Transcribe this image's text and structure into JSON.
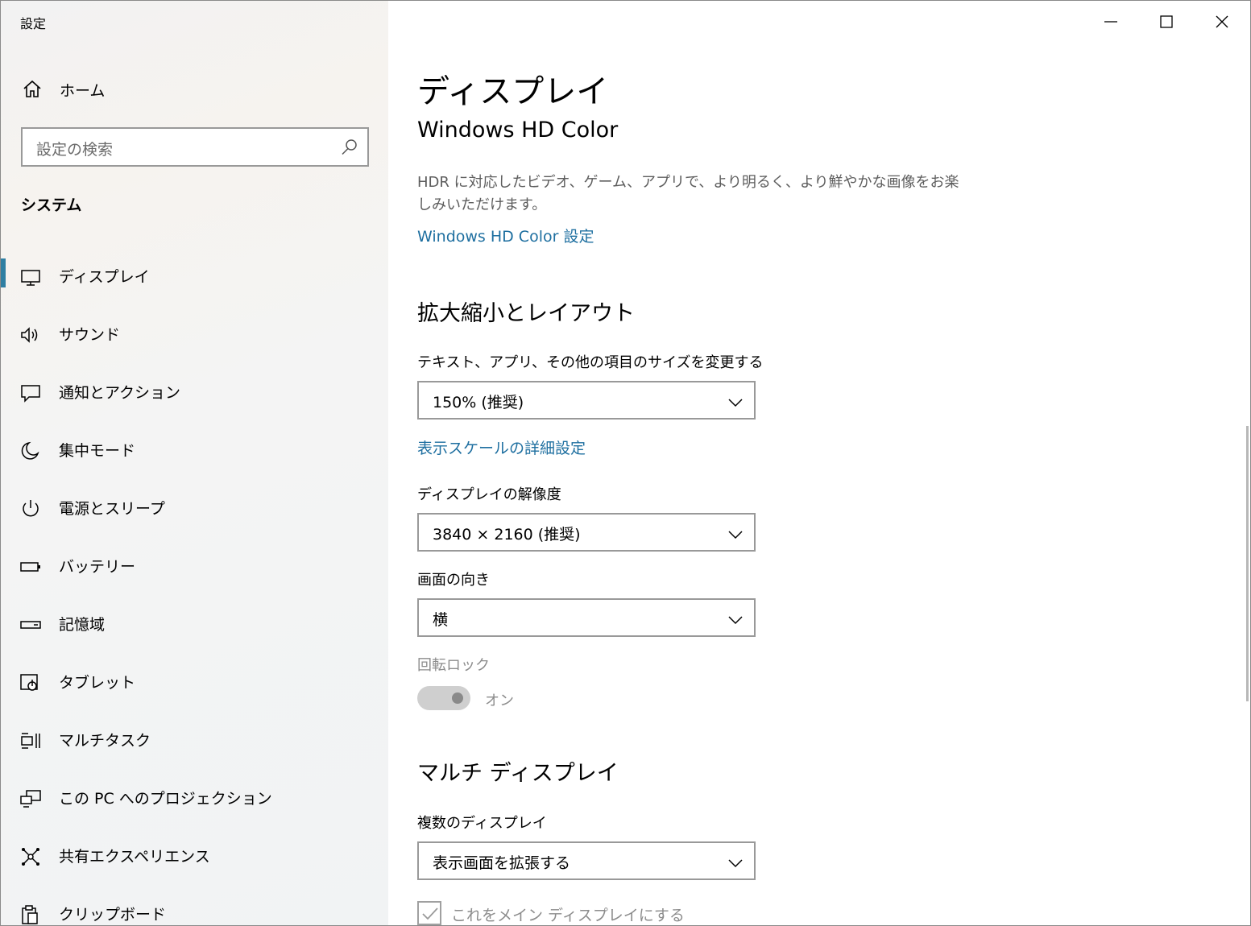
{
  "window": {
    "title": "設定",
    "controls": {
      "minimize": "minimize-icon",
      "maximize": "maximize-icon",
      "close": "close-icon"
    }
  },
  "sidebar": {
    "home_label": "ホーム",
    "search_placeholder": "設定の検索",
    "section_title": "システム",
    "items": [
      {
        "label": "ディスプレイ",
        "icon": "monitor-icon",
        "selected": true
      },
      {
        "label": "サウンド",
        "icon": "speaker-icon"
      },
      {
        "label": "通知とアクション",
        "icon": "notification-icon"
      },
      {
        "label": "集中モード",
        "icon": "moon-icon"
      },
      {
        "label": "電源とスリープ",
        "icon": "power-icon"
      },
      {
        "label": "バッテリー",
        "icon": "battery-icon"
      },
      {
        "label": "記憶域",
        "icon": "storage-icon"
      },
      {
        "label": "タブレット",
        "icon": "tablet-icon"
      },
      {
        "label": "マルチタスク",
        "icon": "multitask-icon"
      },
      {
        "label": "この PC へのプロジェクション",
        "icon": "projection-icon"
      },
      {
        "label": "共有エクスペリエンス",
        "icon": "shared-icon"
      },
      {
        "label": "クリップボード",
        "icon": "clipboard-icon"
      }
    ],
    "accent_color": "#2f7fa3"
  },
  "main": {
    "title": "ディスプレイ",
    "hd_color": {
      "heading": "Windows HD Color",
      "description": "HDR に対応したビデオ、ゲーム、アプリで、より明るく、より鮮やかな画像をお楽しみいただけます。",
      "link": "Windows HD Color 設定"
    },
    "scale_layout": {
      "heading": "拡大縮小とレイアウト",
      "size_label": "テキスト、アプリ、その他の項目のサイズを変更する",
      "size_value": "150% (推奨)",
      "advanced_link": "表示スケールの詳細設定",
      "resolution_label": "ディスプレイの解像度",
      "resolution_value": "3840 × 2160 (推奨)",
      "orientation_label": "画面の向き",
      "orientation_value": "横",
      "rotation_lock_label": "回転ロック",
      "rotation_lock_state": "オン"
    },
    "multi_display": {
      "heading": "マルチ ディスプレイ",
      "multiple_label": "複数のディスプレイ",
      "multiple_value": "表示画面を拡張する",
      "main_display_checkbox": "これをメイン ディスプレイにする"
    },
    "link_color": "#1e6fa0"
  }
}
